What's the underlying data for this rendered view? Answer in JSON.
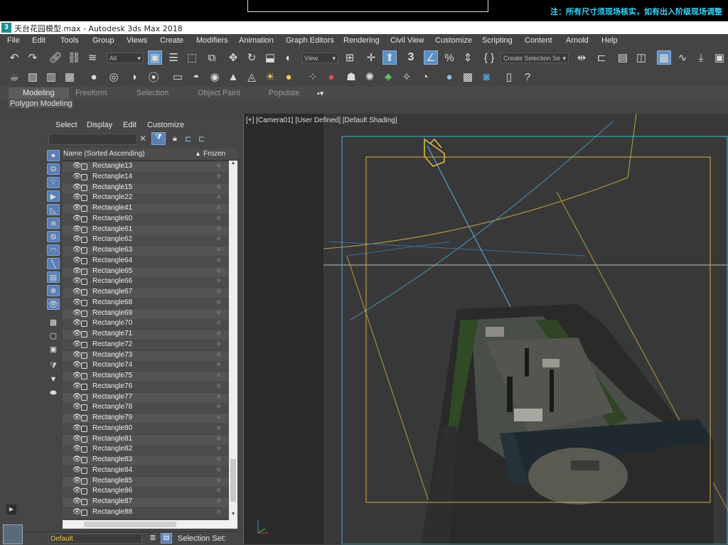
{
  "top_note": "注：所有尺寸须现场核实，如有出入阶级现场调整",
  "window": {
    "title": "天台花园模型.max - Autodesk 3ds Max 2018",
    "app_icon": "3"
  },
  "menu": [
    "File",
    "Edit",
    "Tools",
    "Group",
    "Views",
    "Create",
    "Modifiers",
    "Animation",
    "Graph Editors",
    "Rendering",
    "Civil View",
    "Customize",
    "Scripting",
    "Content",
    "Arnold",
    "Help"
  ],
  "toolbar": {
    "filter_value": "All",
    "coord_value": "View",
    "selection_set_placeholder": "Create Selection Se"
  },
  "ribbon": {
    "tabs": [
      "Modeling",
      "Freeform",
      "Selection",
      "Object Paint",
      "Populate"
    ],
    "active": "Modeling",
    "panel": "Polygon Modeling"
  },
  "explorer": {
    "menu": [
      "Select",
      "Display",
      "Edit",
      "Customize"
    ],
    "col_name": "Name (Sorted Ascending)",
    "col_frozen": "Frozen",
    "rows": [
      "Rectangle13",
      "Rectangle14",
      "Rectangle15",
      "Rectangle22",
      "Rectangle41",
      "Rectangle60",
      "Rectangle61",
      "Rectangle62",
      "Rectangle63",
      "Rectangle64",
      "Rectangle65",
      "Rectangle66",
      "Rectangle67",
      "Rectangle68",
      "Rectangle69",
      "Rectangle70",
      "Rectangle71",
      "Rectangle72",
      "Rectangle73",
      "Rectangle74",
      "Rectangle75",
      "Rectangle76",
      "Rectangle77",
      "Rectangle78",
      "Rectangle79",
      "Rectangle80",
      "Rectangle81",
      "Rectangle82",
      "Rectangle83",
      "Rectangle84",
      "Rectangle85",
      "Rectangle86",
      "Rectangle87",
      "Rectangle88"
    ],
    "layer": "Default",
    "selection_set_label": "Selection Set:"
  },
  "viewport": {
    "label": "[+] [Camera01] [User Defined] [Default Shading]"
  },
  "colors": {
    "accent": "#5b8fc4",
    "frame_yellow": "#d4b13a",
    "frame_cyan": "#3ab8d0",
    "layer_text": "#e8c94a"
  }
}
